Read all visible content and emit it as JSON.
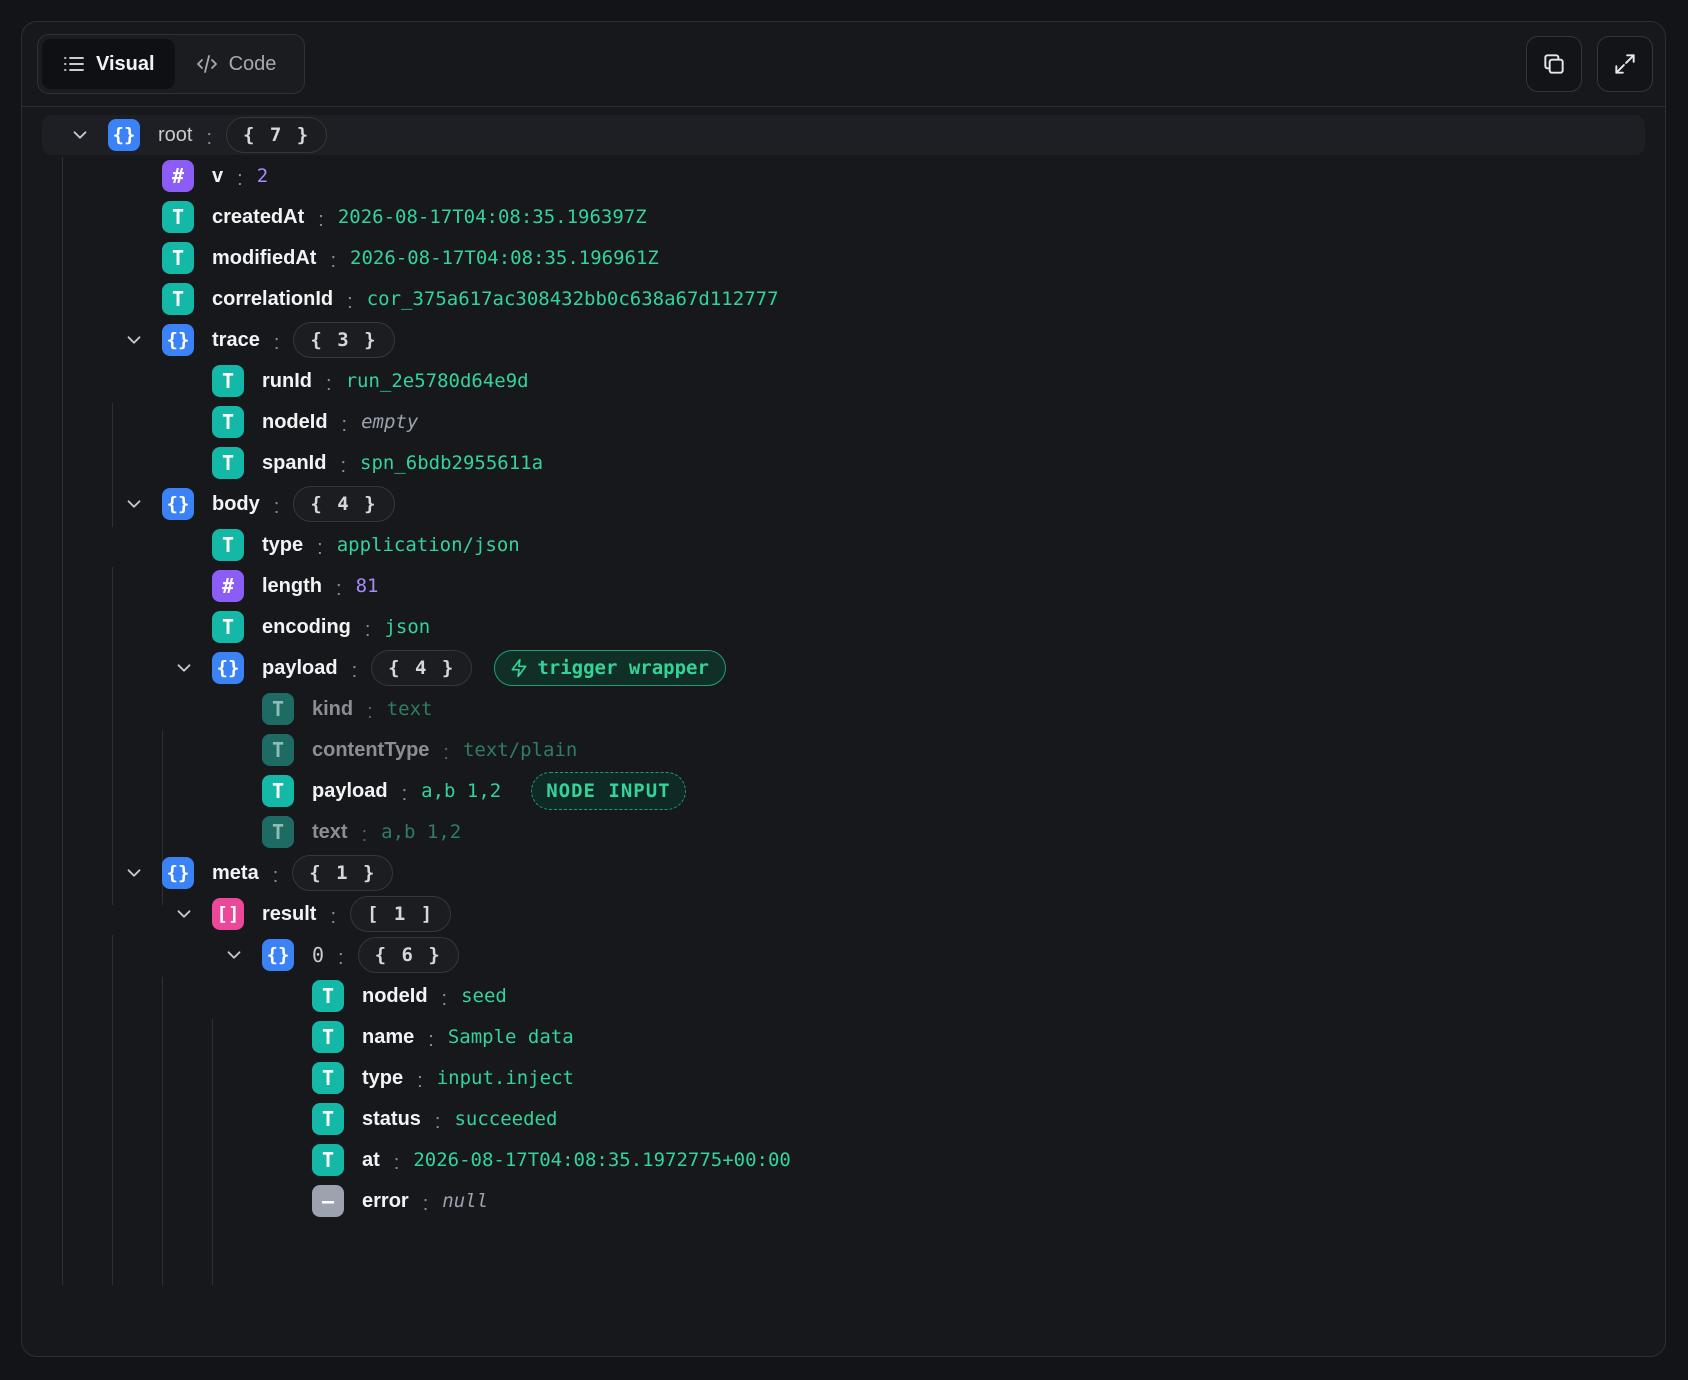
{
  "toolbar": {
    "visual_label": "Visual",
    "code_label": "Code",
    "list_icon": "list-icon",
    "code_icon": "code-icon",
    "copy_icon": "copy-icon",
    "expand_icon": "expand-icon"
  },
  "colors": {
    "object": "#3b82f6",
    "array": "#ec4899",
    "string": "#14b8a6",
    "number": "#8b5cf6",
    "null": "#9ca3af",
    "string_value": "#34d399",
    "number_value": "#a78bfa"
  },
  "tree": {
    "root": {
      "key": "root",
      "count": "{ 7 }"
    },
    "v": {
      "key": "v",
      "value": "2"
    },
    "createdAt": {
      "key": "createdAt",
      "value": "2026-08-17T04:08:35.196397Z"
    },
    "modifiedAt": {
      "key": "modifiedAt",
      "value": "2026-08-17T04:08:35.196961Z"
    },
    "correlationId": {
      "key": "correlationId",
      "value": "cor_375a617ac308432bb0c638a67d112777"
    },
    "trace": {
      "key": "trace",
      "count": "{ 3 }",
      "runId": {
        "key": "runId",
        "value": "run_2e5780d64e9d"
      },
      "nodeId": {
        "key": "nodeId",
        "value": "empty"
      },
      "spanId": {
        "key": "spanId",
        "value": "spn_6bdb2955611a"
      }
    },
    "body": {
      "key": "body",
      "count": "{ 4 }",
      "type": {
        "key": "type",
        "value": "application/json"
      },
      "length": {
        "key": "length",
        "value": "81"
      },
      "encoding": {
        "key": "encoding",
        "value": "json"
      },
      "payload": {
        "key": "payload",
        "count": "{ 4 }",
        "badge": "trigger wrapper",
        "kind": {
          "key": "kind",
          "value": "text"
        },
        "contentType": {
          "key": "contentType",
          "value": "text/plain"
        },
        "payload": {
          "key": "payload",
          "value": "a,b 1,2",
          "badge": "NODE INPUT"
        },
        "text": {
          "key": "text",
          "value": "a,b 1,2"
        }
      }
    },
    "meta": {
      "key": "meta",
      "count": "{ 1 }",
      "result": {
        "key": "result",
        "count": "[ 1 ]",
        "item0": {
          "key": "0",
          "count": "{ 6 }",
          "nodeId": {
            "key": "nodeId",
            "value": "seed"
          },
          "name": {
            "key": "name",
            "value": "Sample data"
          },
          "type": {
            "key": "type",
            "value": "input.inject"
          },
          "status": {
            "key": "status",
            "value": "succeeded"
          },
          "at": {
            "key": "at",
            "value": "2026-08-17T04:08:35.1972775+00:00"
          },
          "error": {
            "key": "error",
            "value": "null"
          }
        }
      }
    }
  }
}
